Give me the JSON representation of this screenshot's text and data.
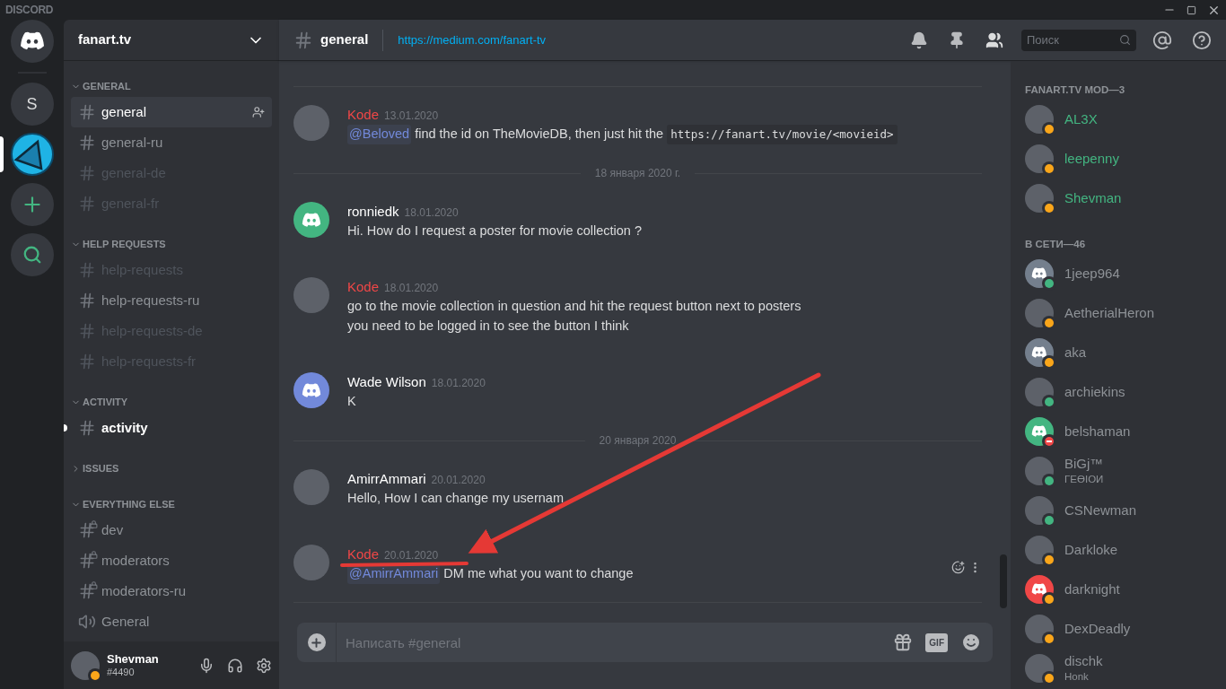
{
  "app_title": "DISCORD",
  "servers": [
    {
      "kind": "home",
      "selected": false
    },
    {
      "kind": "letter",
      "label": "S",
      "selected": false
    },
    {
      "kind": "image",
      "selected": true
    },
    {
      "kind": "add",
      "selected": false
    },
    {
      "kind": "explore",
      "selected": false
    }
  ],
  "server": {
    "name": "fanart.tv"
  },
  "categories": [
    {
      "name": "GENERAL",
      "expanded": true,
      "channels": [
        {
          "name": "general",
          "kind": "text",
          "selected": true,
          "unread": false,
          "muted": false
        },
        {
          "name": "general-ru",
          "kind": "text",
          "selected": false,
          "unread": false,
          "muted": false
        },
        {
          "name": "general-de",
          "kind": "text",
          "selected": false,
          "unread": false,
          "muted": true
        },
        {
          "name": "general-fr",
          "kind": "text",
          "selected": false,
          "unread": false,
          "muted": true
        }
      ]
    },
    {
      "name": "HELP REQUESTS",
      "expanded": true,
      "channels": [
        {
          "name": "help-requests",
          "kind": "text",
          "selected": false,
          "unread": false,
          "muted": true
        },
        {
          "name": "help-requests-ru",
          "kind": "text",
          "selected": false,
          "unread": false,
          "muted": false
        },
        {
          "name": "help-requests-de",
          "kind": "text",
          "selected": false,
          "unread": false,
          "muted": true
        },
        {
          "name": "help-requests-fr",
          "kind": "text",
          "selected": false,
          "unread": false,
          "muted": true
        }
      ]
    },
    {
      "name": "ACTIVITY",
      "expanded": true,
      "channels": [
        {
          "name": "activity",
          "kind": "text",
          "selected": false,
          "unread": true,
          "muted": false
        }
      ]
    },
    {
      "name": "ISSUES",
      "expanded": false
    },
    {
      "name": "EVERYTHING ELSE",
      "expanded": true,
      "channels": [
        {
          "name": "dev",
          "kind": "locked",
          "selected": false,
          "unread": false,
          "muted": false
        },
        {
          "name": "moderators",
          "kind": "locked",
          "selected": false,
          "unread": false,
          "muted": false
        },
        {
          "name": "moderators-ru",
          "kind": "locked",
          "selected": false,
          "unread": false,
          "muted": false
        },
        {
          "name": "General",
          "kind": "voice",
          "selected": false,
          "unread": false,
          "muted": false
        }
      ]
    }
  ],
  "user": {
    "name": "Shevman",
    "tag": "#4490",
    "status": {
      "kind": "idle",
      "color": "#faa61a"
    }
  },
  "channel_header": {
    "name": "general",
    "topic": "https://medium.com/fanart-tv"
  },
  "search": {
    "placeholder": "Поиск"
  },
  "messages": [
    {
      "kind": "message",
      "author": "Kode",
      "color": "#f04747",
      "timestamp": "13.01.2020",
      "avatar": {
        "kind": "photo"
      },
      "actions_visible": false,
      "lines": [
        [
          {
            "kind": "mention",
            "text": "@Beloved"
          },
          {
            "kind": "text",
            "text": " find the id on TheMovieDB, then just hit the "
          },
          {
            "kind": "code",
            "text": "https://fanart.tv/movie/<movieid>"
          }
        ]
      ]
    },
    {
      "kind": "date",
      "label": "18 января 2020 г."
    },
    {
      "kind": "message",
      "author": "ronniedk",
      "color": "#ffffff",
      "timestamp": "18.01.2020",
      "avatar": {
        "kind": "logo",
        "color": "#43b581"
      },
      "actions_visible": false,
      "lines": [
        [
          {
            "kind": "text",
            "text": "Hi. How do I request a poster for movie collection ?"
          }
        ]
      ]
    },
    {
      "kind": "message",
      "author": "Kode",
      "color": "#f04747",
      "timestamp": "18.01.2020",
      "avatar": {
        "kind": "photo"
      },
      "actions_visible": false,
      "lines": [
        [
          {
            "kind": "text",
            "text": "go to the movie collection in question and hit the request button next to posters"
          }
        ],
        [
          {
            "kind": "text",
            "text": "you need to be logged in to see the button I think"
          }
        ]
      ]
    },
    {
      "kind": "message",
      "author": "Wade Wilson",
      "color": "#ffffff",
      "timestamp": "18.01.2020",
      "avatar": {
        "kind": "logo",
        "color": "#7289da"
      },
      "actions_visible": false,
      "lines": [
        [
          {
            "kind": "text",
            "text": "K"
          }
        ]
      ]
    },
    {
      "kind": "date",
      "label": "20 января 2020"
    },
    {
      "kind": "message",
      "author": "AmirrAmmari",
      "color": "#ffffff",
      "timestamp": "20.01.2020",
      "avatar": {
        "kind": "photo"
      },
      "actions_visible": false,
      "lines": [
        [
          {
            "kind": "text",
            "text": "Hello, How I can change my usernam"
          }
        ]
      ]
    },
    {
      "kind": "message",
      "author": "Kode",
      "color": "#f04747",
      "timestamp": "20.01.2020",
      "avatar": {
        "kind": "photo"
      },
      "actions_visible": true,
      "lines": [
        [
          {
            "kind": "mention",
            "text": "@AmirrAmmari"
          },
          {
            "kind": "text",
            "text": " DM me what you want to change"
          }
        ]
      ]
    }
  ],
  "composer": {
    "placeholder": "Написать #general",
    "gif_label": "GIF"
  },
  "member_groups": [
    {
      "title": "FANART.TV MOD—3",
      "members": [
        {
          "name": "AL3X",
          "color": "#43b581",
          "status": {
            "kind": "idle",
            "color": "#faa61a"
          },
          "avatar": {
            "kind": "photo"
          }
        },
        {
          "name": "leepenny",
          "color": "#43b581",
          "status": {
            "kind": "idle",
            "color": "#faa61a"
          },
          "avatar": {
            "kind": "photo"
          }
        },
        {
          "name": "Shevman",
          "color": "#43b581",
          "status": {
            "kind": "idle",
            "color": "#faa61a"
          },
          "avatar": {
            "kind": "photo"
          }
        }
      ]
    },
    {
      "title": "В СЕТИ—46",
      "members": [
        {
          "name": "1jeep964",
          "color": "#8e9297",
          "status": {
            "kind": "online",
            "color": "#43b581"
          },
          "avatar": {
            "kind": "logo",
            "color": "#747f8d"
          }
        },
        {
          "name": "AetherialHeron",
          "color": "#8e9297",
          "status": {
            "kind": "idle",
            "color": "#faa61a"
          },
          "avatar": {
            "kind": "photo"
          }
        },
        {
          "name": "aka",
          "color": "#8e9297",
          "status": {
            "kind": "idle",
            "color": "#faa61a"
          },
          "avatar": {
            "kind": "logo",
            "color": "#747f8d"
          }
        },
        {
          "name": "archiekins",
          "color": "#8e9297",
          "status": {
            "kind": "online",
            "color": "#43b581"
          },
          "avatar": {
            "kind": "photo"
          }
        },
        {
          "name": "belshaman",
          "color": "#8e9297",
          "status": {
            "kind": "dnd",
            "color": "#f04747"
          },
          "avatar": {
            "kind": "logo",
            "color": "#43b581"
          }
        },
        {
          "name": "BiGj™",
          "subtext": "ΓΕϴIOИ",
          "color": "#8e9297",
          "status": {
            "kind": "online",
            "color": "#43b581"
          },
          "avatar": {
            "kind": "photo"
          }
        },
        {
          "name": "CSNewman",
          "color": "#8e9297",
          "status": {
            "kind": "online",
            "color": "#43b581"
          },
          "avatar": {
            "kind": "photo"
          }
        },
        {
          "name": "Darkloke",
          "color": "#8e9297",
          "status": {
            "kind": "idle",
            "color": "#faa61a"
          },
          "avatar": {
            "kind": "photo"
          }
        },
        {
          "name": "darknight",
          "color": "#8e9297",
          "status": {
            "kind": "idle",
            "color": "#faa61a"
          },
          "avatar": {
            "kind": "logo",
            "color": "#f04747"
          }
        },
        {
          "name": "DexDeadly",
          "color": "#8e9297",
          "status": {
            "kind": "idle",
            "color": "#faa61a"
          },
          "avatar": {
            "kind": "photo"
          }
        },
        {
          "name": "dischk",
          "subtext": "Honk",
          "color": "#8e9297",
          "status": {
            "kind": "idle",
            "color": "#faa61a"
          },
          "avatar": {
            "kind": "photo"
          }
        }
      ]
    }
  ]
}
